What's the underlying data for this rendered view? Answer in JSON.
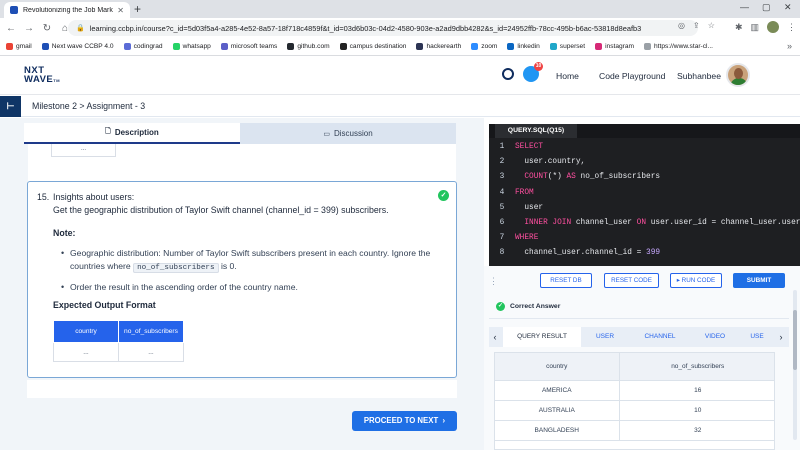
{
  "browser": {
    "tab_title": "Revolutionizing the Job Market |",
    "url": "learning.ccbp.in/course?c_id=5d03f5a4-a285-4e52-8a57-18f718c4859f&t_id=03d6b03c-04d2-4580-903e-a2ad9dbb4282&s_id=24952ffb-78cc-495b-b6ac-53818d8eafb3",
    "bookmarks": [
      {
        "label": "gmail",
        "icon": "gmail-icon",
        "color": "#ea4335"
      },
      {
        "label": "Next wave CCBP 4.0",
        "icon": "nxtwave-icon",
        "color": "#1e4fb5"
      },
      {
        "label": "codingrad",
        "icon": "codingrad-icon",
        "color": "#5b6bd6"
      },
      {
        "label": "whatsapp",
        "icon": "whatsapp-icon",
        "color": "#25d366"
      },
      {
        "label": "microsoft teams",
        "icon": "teams-icon",
        "color": "#5b5fc7"
      },
      {
        "label": "github.com",
        "icon": "github-icon",
        "color": "#24292f"
      },
      {
        "label": "campus destination",
        "icon": "campus-icon",
        "color": "#222"
      },
      {
        "label": "hackerearth",
        "icon": "hackerearth-icon",
        "color": "#2c3454"
      },
      {
        "label": "zoom",
        "icon": "zoom-icon",
        "color": "#2d8cff"
      },
      {
        "label": "linkedin",
        "icon": "linkedin-icon",
        "color": "#0a66c2"
      },
      {
        "label": "superset",
        "icon": "superset-icon",
        "color": "#20a7c9"
      },
      {
        "label": "instagram",
        "icon": "instagram-icon",
        "color": "#d62976"
      },
      {
        "label": "https://www.star-cl...",
        "icon": "web-icon",
        "color": "#9aa0a6"
      }
    ]
  },
  "header": {
    "logo_line1": "NXT",
    "logo_line2": "WAVE",
    "logo_tm": "TM",
    "chat_badge": "10",
    "nav_home": "Home",
    "nav_playground": "Code Playground",
    "user_name": "Subhanbee"
  },
  "breadcrumb": {
    "text": "Milestone 2 > Assignment - 3"
  },
  "left": {
    "tab_description": "Description",
    "tab_discussion": "Discussion",
    "prev_cell": "...",
    "question_number": "15.",
    "question_title": "Insights about users:",
    "question_desc": "Get the geographic distribution of Taylor Swift channel (channel_id = 399) subscribers.",
    "note_title": "Note:",
    "note_1_prefix": "Geographic distribution: Number of Taylor Swift subscribers present in each country. Ignore the countries where",
    "note_1_code": "no_of_subscribers",
    "note_1_suffix": "is 0.",
    "note_2": "Order the result in the ascending order of the country name.",
    "expected_title": "Expected Output Format",
    "expected_headers": [
      "country",
      "no_of_subscribers"
    ],
    "expected_row": [
      "...",
      "..."
    ],
    "proceed_label": "PROCEED TO NEXT"
  },
  "editor": {
    "file_tab": "QUERY.SQL(Q15)",
    "lines": [
      {
        "n": "1",
        "parts": [
          {
            "t": "SELECT",
            "c": "kw"
          }
        ]
      },
      {
        "n": "2",
        "parts": [
          {
            "t": "  user.country,",
            "c": "id"
          }
        ]
      },
      {
        "n": "3",
        "parts": [
          {
            "t": "  COUNT",
            "c": "kw"
          },
          {
            "t": "(*) ",
            "c": "id"
          },
          {
            "t": "AS",
            "c": "kw"
          },
          {
            "t": " no_of_subscribers",
            "c": "id"
          }
        ]
      },
      {
        "n": "4",
        "parts": [
          {
            "t": "FROM",
            "c": "kw"
          }
        ]
      },
      {
        "n": "5",
        "parts": [
          {
            "t": "  user",
            "c": "id"
          }
        ]
      },
      {
        "n": "6",
        "parts": [
          {
            "t": "  INNER JOIN",
            "c": "kw"
          },
          {
            "t": " channel_user ",
            "c": "id"
          },
          {
            "t": "ON",
            "c": "kw"
          },
          {
            "t": " user.user_id = channel_user.user_id",
            "c": "id"
          }
        ]
      },
      {
        "n": "7",
        "parts": [
          {
            "t": "WHERE",
            "c": "kw"
          }
        ]
      },
      {
        "n": "8",
        "parts": [
          {
            "t": "  channel_user.channel_id = ",
            "c": "id"
          },
          {
            "t": "399",
            "c": "num"
          }
        ]
      }
    ],
    "btn_reset_db": "RESET DB",
    "btn_reset_code": "RESET CODE",
    "btn_run": "RUN CODE",
    "btn_submit": "SUBMIT",
    "status": "Correct Answer"
  },
  "results": {
    "tabs": [
      "QUERY RESULT",
      "USER",
      "CHANNEL",
      "VIDEO",
      "USE"
    ],
    "headers": [
      "country",
      "no_of_subscribers"
    ],
    "rows": [
      [
        "AMERICA",
        "16"
      ],
      [
        "AUSTRALIA",
        "10"
      ],
      [
        "BANGLADESH",
        "32"
      ]
    ]
  }
}
